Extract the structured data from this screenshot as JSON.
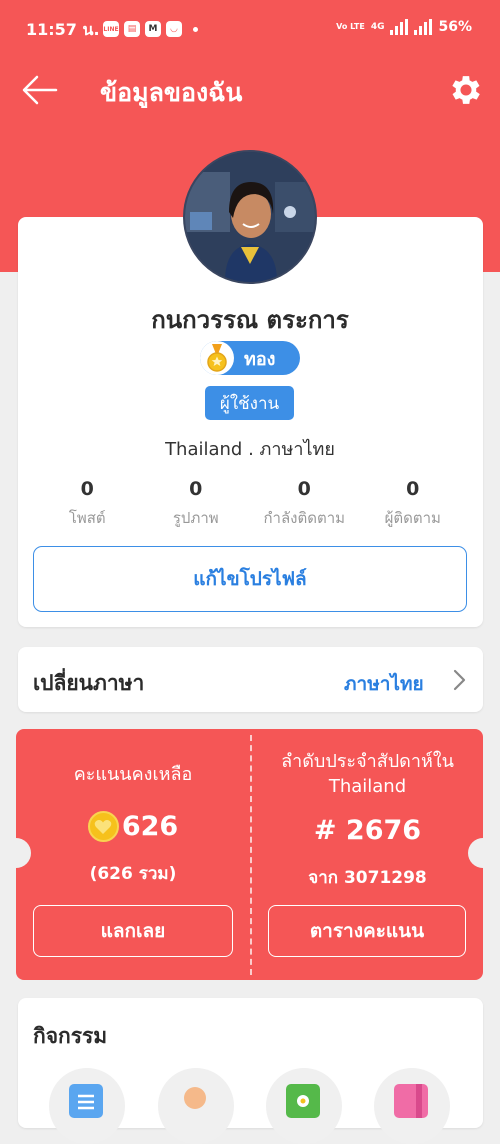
{
  "status_bar": {
    "time": "11:57 น.",
    "app_icons": [
      "LINE",
      "M"
    ],
    "network_type": "Vo LTE",
    "signal": "4G",
    "battery": "56%"
  },
  "header": {
    "title": "ข้อมูลของฉัน"
  },
  "profile": {
    "name": "กนกวรรณ ตระการ",
    "level": "ทอง",
    "role": "ผู้ใช้งาน",
    "location": "Thailand . ภาษาไทย",
    "stats": [
      {
        "value": "0",
        "label": "โพสต์"
      },
      {
        "value": "0",
        "label": "รูปภาพ"
      },
      {
        "value": "0",
        "label": "กำลังติดตาม"
      },
      {
        "value": "0",
        "label": "ผู้ติดตาม"
      }
    ],
    "edit_label": "แก้ไขโปรไฟล์"
  },
  "language": {
    "title": "เปลี่ยนภาษา",
    "current": "ภาษาไทย"
  },
  "points": {
    "remaining_label": "คะแนนคงเหลือ",
    "remaining_value": "626",
    "total": "(626 รวม)",
    "redeem_label": "แลกเลย",
    "rank_label_line1": "ลำดับประจำสัปดาห์ใน",
    "rank_label_line2": "Thailand",
    "rank_value": "# 2676",
    "rank_of": "จาก 3071298",
    "leaderboard_label": "ตารางคะแนน"
  },
  "activity": {
    "title": "กิจกรรม"
  },
  "colors": {
    "primary_red": "#f55656",
    "accent_blue": "#3d8fe6",
    "link_blue": "#2a7fe0",
    "background": "#efefef",
    "coin_gold": "#f6c11c"
  }
}
